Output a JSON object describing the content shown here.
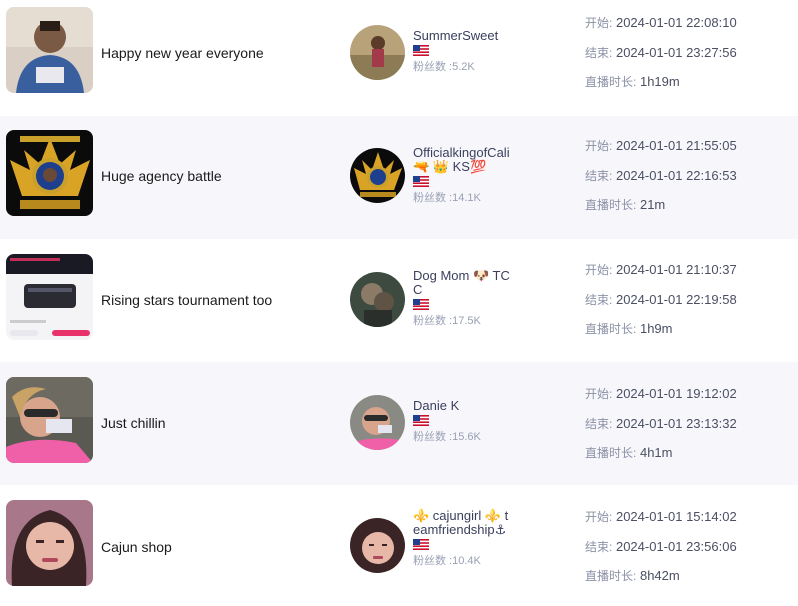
{
  "labels": {
    "fans_prefix": "粉丝数 :",
    "start": "开始: ",
    "end": "结束: ",
    "duration": "直播时长: "
  },
  "streams": [
    {
      "title": "Happy new year everyone",
      "user_name": "SummerSweet",
      "country_flag": "us-flag-icon",
      "fans": "粉丝数 :5.2K",
      "start_label": "开始:",
      "start": "2024-01-01 22:08:10",
      "end_label": "结束:",
      "end": "2024-01-01 23:27:56",
      "duration_label": "直播时长:",
      "duration": "1h19m"
    },
    {
      "title": "Huge agency battle",
      "user_name": "OfficialkingofCali🔫 👑 KS💯",
      "country_flag": "us-flag-icon",
      "fans": "粉丝数 :14.1K",
      "start_label": "开始:",
      "start": "2024-01-01 21:55:05",
      "end_label": "结束:",
      "end": "2024-01-01 22:16:53",
      "duration_label": "直播时长:",
      "duration": "21m"
    },
    {
      "title": "Rising stars tournament too",
      "user_name": "Dog Mom 🐶 TCC",
      "country_flag": "us-flag-icon",
      "fans": "粉丝数 :17.5K",
      "start_label": "开始:",
      "start": "2024-01-01 21:10:37",
      "end_label": "结束:",
      "end": "2024-01-01 22:19:58",
      "duration_label": "直播时长:",
      "duration": "1h9m"
    },
    {
      "title": "Just chillin",
      "user_name": "Danie K",
      "country_flag": "us-flag-icon",
      "fans": "粉丝数 :15.6K",
      "start_label": "开始:",
      "start": "2024-01-01 19:12:02",
      "end_label": "结束:",
      "end": "2024-01-01 23:13:32",
      "duration_label": "直播时长:",
      "duration": "4h1m"
    },
    {
      "title": "Cajun shop",
      "user_name": "⚜️ cajungirl ⚜️ teamfriendship⚓",
      "country_flag": "us-flag-icon",
      "fans": "粉丝数 :10.4K",
      "start_label": "开始:",
      "start": "2024-01-01 15:14:02",
      "end_label": "结束:",
      "end": "2024-01-01 23:56:06",
      "duration_label": "直播时长:",
      "duration": "8h42m"
    }
  ]
}
